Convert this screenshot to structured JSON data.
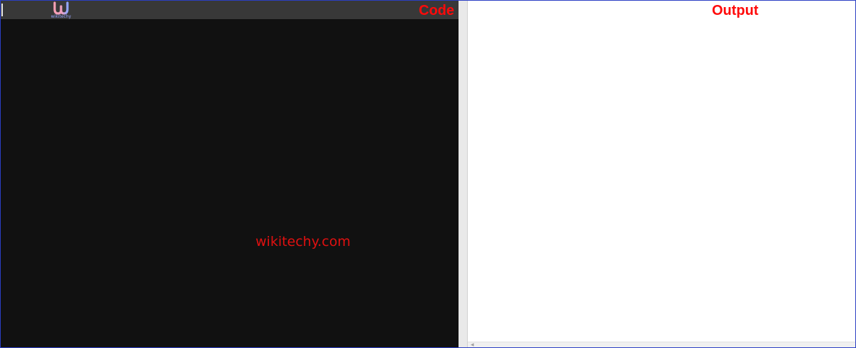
{
  "window": {
    "border_color": "#2b3fc4"
  },
  "code_pane": {
    "label": "Code",
    "label_color": "#ff0a0a",
    "background": "#111111",
    "header_background": "#383838",
    "logo": {
      "icon": "wikitechy-logo-icon",
      "text": "wikitechy"
    },
    "watermark": "wikitechy.com"
  },
  "output_pane": {
    "label": "Output",
    "label_color": "#ff0a0a",
    "background": "#ffffff",
    "scroll_arrow_icon": "scroll-left-arrow-icon"
  }
}
